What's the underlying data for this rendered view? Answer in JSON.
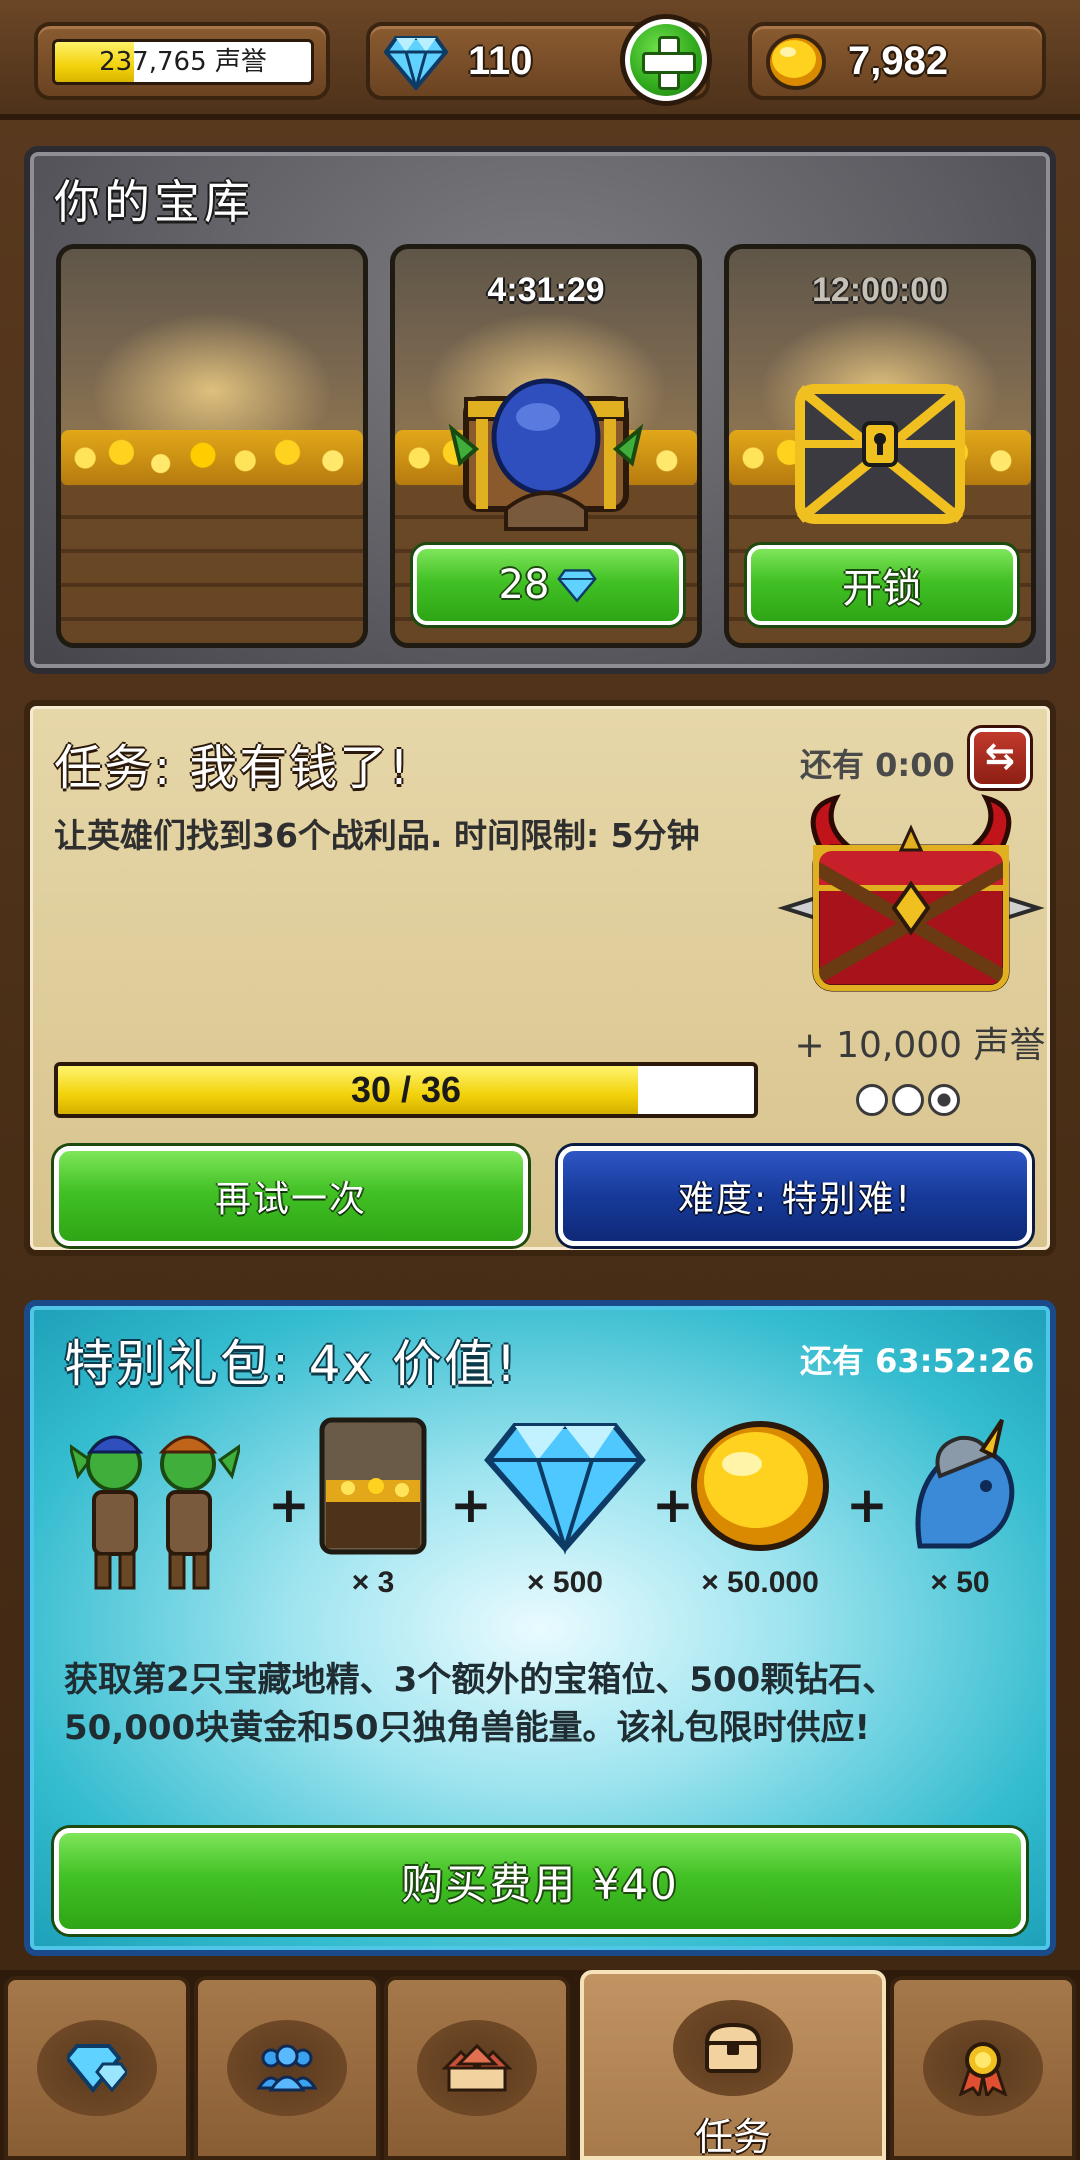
{
  "topbar": {
    "reputation_text": "237,765 声誉",
    "reputation_fill": 0.31,
    "gems": "110",
    "gold": "7,982"
  },
  "vault": {
    "title": "你的宝库",
    "slots": [
      {
        "timer": "",
        "button": ""
      },
      {
        "timer": "4:31:29",
        "button": "28"
      },
      {
        "timer": "12:00:00",
        "button": "开锁"
      }
    ]
  },
  "quest": {
    "title": "任务: 我有钱了!",
    "remaining": "还有 0:00",
    "description": "让英雄们找到36个战利品. 时间限制: 5分钟",
    "reward": "+ 10,000 声誉",
    "progress_text": "30 / 36",
    "progress": {
      "current": 30,
      "total": 36
    },
    "difficulty_circles": {
      "filled": 1,
      "total": 3
    },
    "retry_label": "再试一次",
    "difficulty_label": "难度: 特别难!"
  },
  "offer": {
    "title": "特别礼包:  4x 价值!",
    "remaining": "还有 63:52:26",
    "items": [
      {
        "icon": "goblins-icon",
        "label": ""
      },
      {
        "icon": "vault-slot-icon",
        "label": "× 3"
      },
      {
        "icon": "diamond-icon",
        "label": "× 500"
      },
      {
        "icon": "gold-coin-icon",
        "label": "× 50.000"
      },
      {
        "icon": "unicorn-icon",
        "label": "× 50"
      }
    ],
    "plus": "+",
    "description": "获取第2只宝藏地精、3个额外的宝箱位、500颗钻石、50,000块黄金和50只独角兽能量。该礼包限时供应!",
    "buy_label": "购买费用 ¥40"
  },
  "nav": {
    "tabs": [
      {
        "icon": "gems-icon",
        "label": ""
      },
      {
        "icon": "heroes-icon",
        "label": ""
      },
      {
        "icon": "town-icon",
        "label": ""
      },
      {
        "icon": "chest-icon",
        "label": "任务"
      },
      {
        "icon": "medal-icon",
        "label": ""
      }
    ],
    "active_index": 3
  },
  "colors": {
    "wood": "#5a3a1f",
    "green_button": "#42c125",
    "blue_button": "#173a9a",
    "progress_yellow": "#f2d20b",
    "offer_teal": "#34bccf"
  }
}
